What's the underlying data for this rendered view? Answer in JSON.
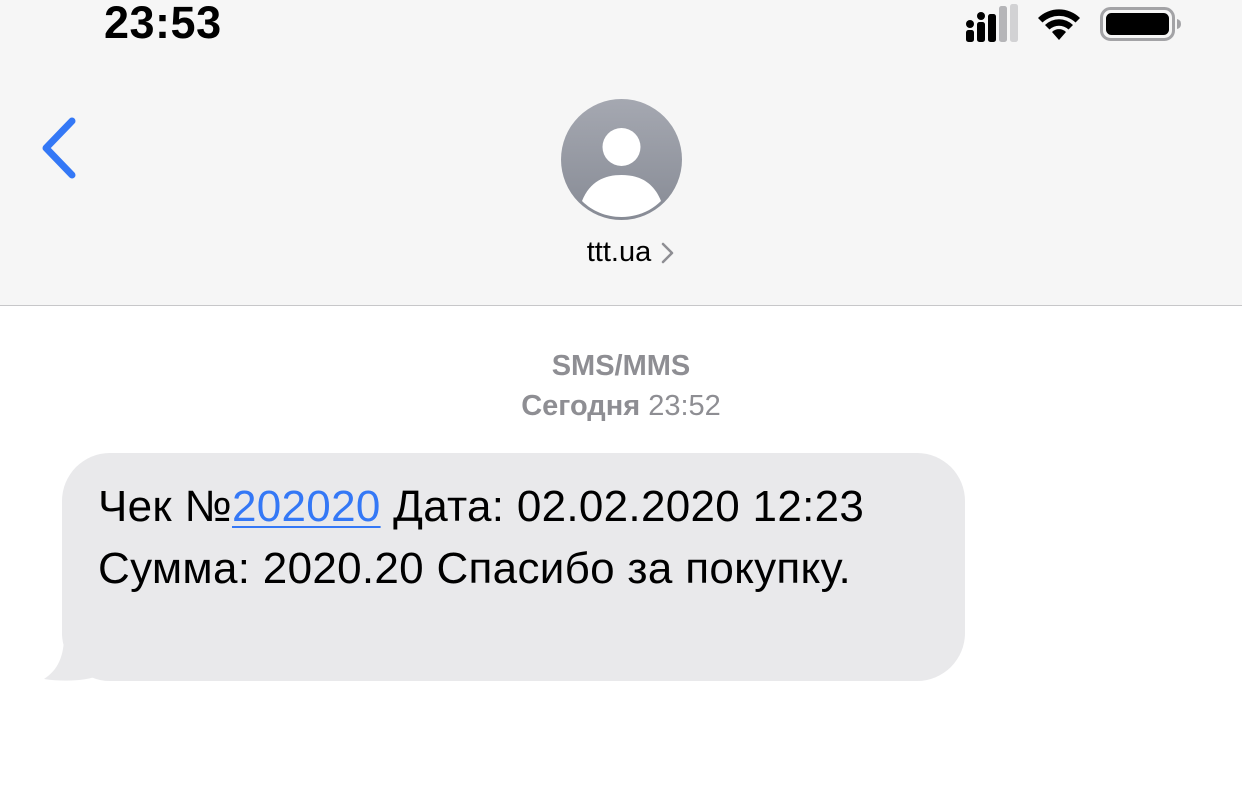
{
  "status_bar": {
    "time": "23:53",
    "icons": [
      "signal-icon",
      "wifi-icon",
      "battery-icon"
    ]
  },
  "header": {
    "back_icon": "chevron-left-icon",
    "avatar_icon": "person-icon",
    "contact_name": "ttt.ua",
    "contact_chevron_icon": "chevron-right-icon"
  },
  "conversation": {
    "service_label": "SMS/MMS",
    "day_label": "Сегодня",
    "time_label": "23:52",
    "message": {
      "part1": "Чек №",
      "link_text": "202020",
      "part2": " Дата: 02.02.2020 12:23 Сумма: 2020.20  Спасибо за покупку."
    }
  },
  "colors": {
    "accent": "#3478f6",
    "header_background": "#f6f6f6",
    "bubble_background": "#e9e9eb",
    "meta_text": "#8e8e93"
  }
}
